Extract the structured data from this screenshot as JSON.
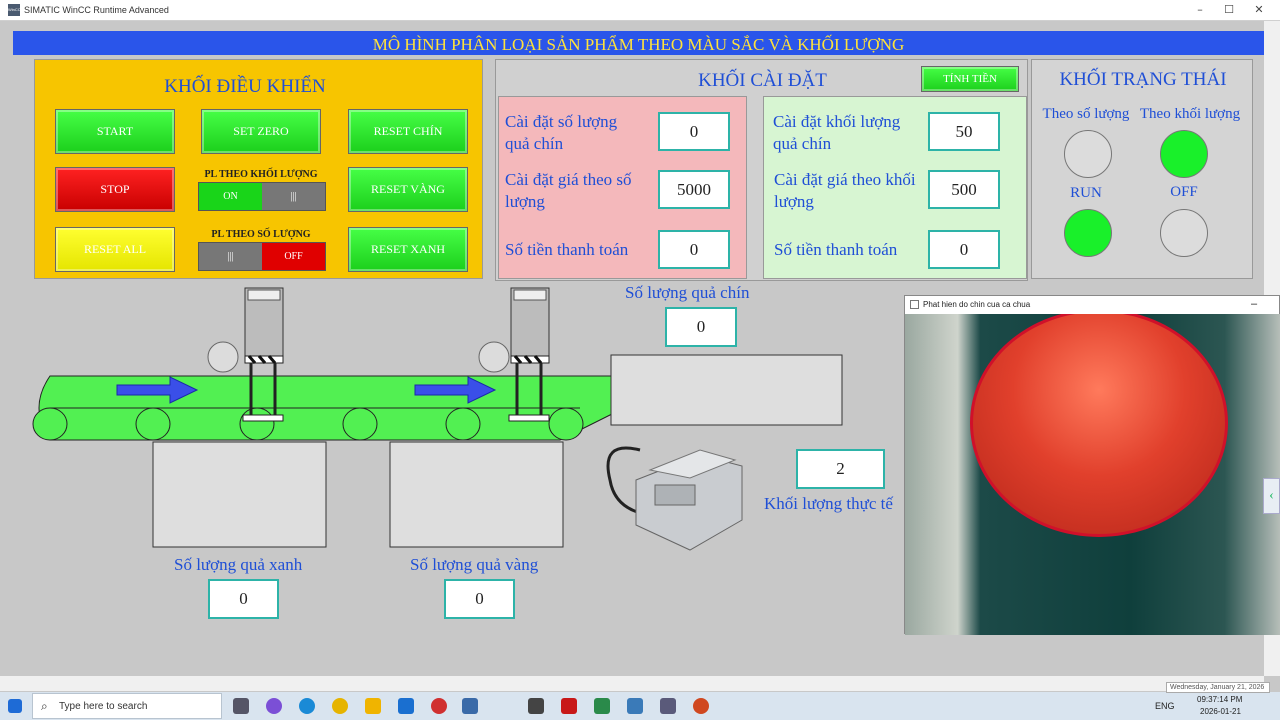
{
  "window": {
    "title": "SIMATIC WinCC Runtime Advanced",
    "logo_text": "WinCC"
  },
  "banner": "MÔ HÌNH PHÂN LOẠI SẢN PHẨM THEO MÀU SẮC VÀ KHỐI LƯỢNG",
  "control": {
    "title": "KHỐI ĐIỀU KHIỂN",
    "start": "START",
    "set_zero": "SET ZERO",
    "reset_chin": "RESET CHÍN",
    "stop": "STOP",
    "pl_khoi_luong": "PL THEO KHỐI LƯỢNG",
    "pl_khoi_luong_on": "ON",
    "pl_khoi_luong_off": "|||",
    "reset_vang": "RESET VÀNG",
    "reset_all": "RESET ALL",
    "pl_so_luong": "PL THEO SỐ LƯỢNG",
    "pl_so_luong_left": "|||",
    "pl_so_luong_off": "OFF",
    "reset_xanh": "RESET XANH"
  },
  "setup": {
    "title": "KHỐI CÀI ĐẶT",
    "tinh_tien": "TÍNH TIỀN",
    "left": {
      "count_label": "Cài đặt số lượng quả chín",
      "count_value": "0",
      "price_label": "Cài đặt giá theo số lượng",
      "price_value": "5000",
      "pay_label": "Số tiền thanh toán",
      "pay_value": "0"
    },
    "right": {
      "weight_label": "Cài đặt khối lượng quả chín",
      "weight_value": "50",
      "price_label": "Cài đặt giá theo khối lượng",
      "price_value": "500",
      "pay_label": "Số tiền thanh toán",
      "pay_value": "0"
    }
  },
  "state": {
    "title": "KHỐI TRẠNG THÁI",
    "by_count": "Theo số lượng",
    "by_weight": "Theo khối lượng",
    "run": "RUN",
    "off": "OFF",
    "lamps": {
      "by_count": "off",
      "by_weight": "on",
      "run": "on",
      "off": "off"
    }
  },
  "process": {
    "ripe_label": "Số lượng quả chín",
    "ripe_value": "0",
    "weight_value": "2",
    "weight_label": "Khối lượng thực tế",
    "green_label": "Số lượng quả xanh",
    "green_value": "0",
    "yellow_label": "Số lượng quả vàng",
    "yellow_value": "0"
  },
  "camera": {
    "title": "Phat hien do chin cua ca chua",
    "min_icon": "minimize-icon"
  },
  "colors": {
    "banner": "#2a55ea",
    "banner_text": "#ffe23a",
    "control_bg": "#f7c500",
    "label_blue": "#1f4fd6",
    "lamp_on": "#19f02a"
  },
  "taskbar": {
    "search_placeholder": "Type here to search",
    "lang": "ENG",
    "time": "09:37:14 PM",
    "date": "2026-01-21",
    "tooltip": "Wednesday, January 21, 2026"
  }
}
